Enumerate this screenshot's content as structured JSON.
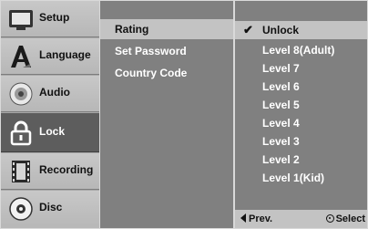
{
  "categories": [
    {
      "label": "Setup",
      "icon": "tv-icon",
      "active": false
    },
    {
      "label": "Language",
      "icon": "language-icon",
      "active": false
    },
    {
      "label": "Audio",
      "icon": "speaker-icon",
      "active": false
    },
    {
      "label": "Lock",
      "icon": "lock-icon",
      "active": true
    },
    {
      "label": "Recording",
      "icon": "film-icon",
      "active": false
    },
    {
      "label": "Disc",
      "icon": "disc-icon",
      "active": false
    }
  ],
  "submenu": [
    {
      "label": "Rating",
      "selected": true
    },
    {
      "label": "Set Password",
      "selected": false
    },
    {
      "label": "Country Code",
      "selected": false
    }
  ],
  "options": [
    {
      "label": "Unlock",
      "checked": true
    },
    {
      "label": "Level 8(Adult)",
      "checked": false
    },
    {
      "label": "Level 7",
      "checked": false
    },
    {
      "label": "Level 6",
      "checked": false
    },
    {
      "label": "Level 5",
      "checked": false
    },
    {
      "label": "Level 4",
      "checked": false
    },
    {
      "label": "Level 3",
      "checked": false
    },
    {
      "label": "Level 2",
      "checked": false
    },
    {
      "label": "Level 1(Kid)",
      "checked": false
    }
  ],
  "hint": {
    "prev_label": "Prev.",
    "select_label": "Select"
  },
  "check_glyph": "✔"
}
